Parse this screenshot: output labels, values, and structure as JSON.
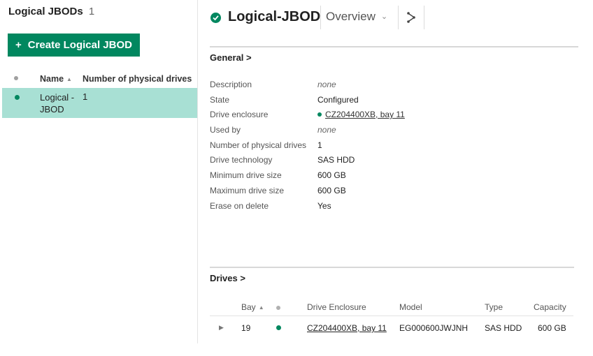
{
  "list": {
    "title": "Logical JBODs",
    "count": "1",
    "create_label": "Create Logical JBOD",
    "columns": {
      "name": "Name",
      "drives": "Number of physical drives"
    },
    "rows": [
      {
        "name": "Logical -JBOD",
        "drives": "1",
        "status": "ok"
      }
    ]
  },
  "detail": {
    "title": "Logical-JBOD",
    "status": "ok",
    "view_select": "Overview",
    "general": {
      "heading": "General >",
      "props": [
        {
          "label": "Description",
          "value": "none"
        },
        {
          "label": "State",
          "value": "Configured"
        },
        {
          "label": "Drive enclosure",
          "value": "CZ204400XB, bay 11"
        },
        {
          "label": "Used by",
          "value": "none"
        },
        {
          "label": "Number of physical drives",
          "value": "1"
        },
        {
          "label": "Drive technology",
          "value": "SAS HDD"
        },
        {
          "label": "Minimum drive size",
          "value": "600 GB"
        },
        {
          "label": "Maximum drive size",
          "value": "600 GB"
        },
        {
          "label": "Erase on delete",
          "value": "Yes"
        }
      ]
    },
    "drives": {
      "heading": "Drives >",
      "columns": {
        "bay": "Bay",
        "enclosure": "Drive Enclosure",
        "model": "Model",
        "type": "Type",
        "capacity": "Capacity"
      },
      "rows": [
        {
          "bay": "19",
          "enclosure": "CZ204400XB, bay 11",
          "model": "EG000600JWJNH",
          "type": "SAS HDD",
          "capacity": "600 GB",
          "status": "ok"
        }
      ]
    }
  },
  "colors": {
    "accent": "#01875f",
    "selected_row": "#a8e0d4"
  }
}
